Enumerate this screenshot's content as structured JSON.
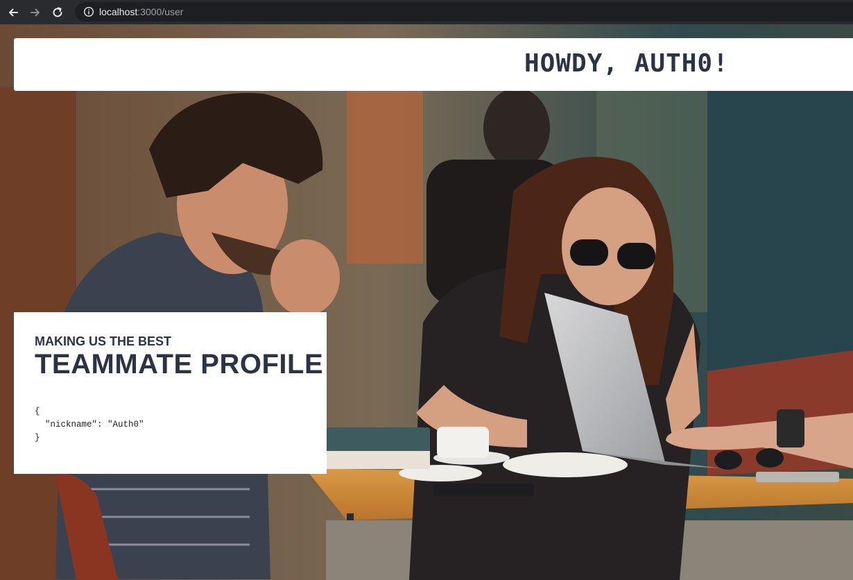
{
  "browser": {
    "url_host": "localhost",
    "url_path": ":3000/user"
  },
  "header": {
    "greeting": "HOWDY, AUTH0!"
  },
  "profile_card": {
    "kicker": "MAKING US THE BEST",
    "title": "TEAMMATE PROFILE",
    "json_lines": [
      "{",
      "  \"nickname\": \"Auth0\"",
      "}"
    ]
  },
  "icons": {
    "back": "back-arrow-icon",
    "forward": "forward-arrow-icon",
    "reload": "reload-icon",
    "site_info": "info-icon"
  },
  "colors": {
    "heading": "#2b3444",
    "banner_bg": "#ffffff",
    "chrome_bg": "#2a2b2e"
  }
}
